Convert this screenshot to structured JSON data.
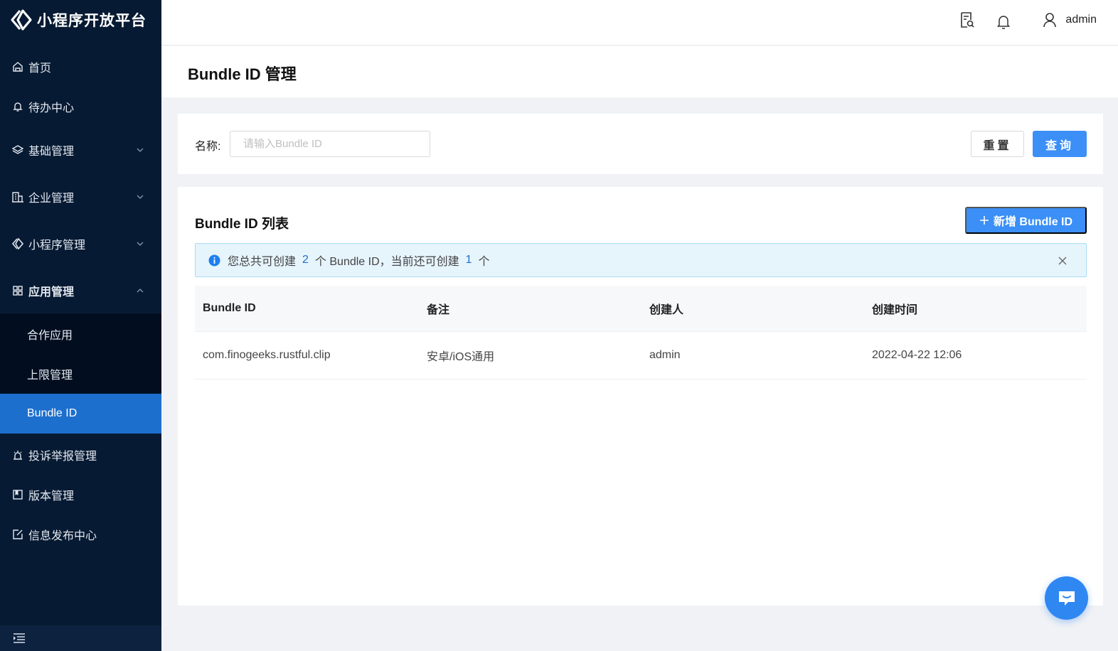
{
  "app": {
    "title": "小程序开放平台",
    "colors": {
      "sidebar": "#071a33",
      "active": "#1d6fce",
      "primary": "#3b8ff7"
    }
  },
  "sidebar": {
    "items": [
      {
        "label": "首页",
        "icon": "home-icon"
      },
      {
        "label": "待办中心",
        "icon": "bell-icon"
      },
      {
        "label": "基础管理",
        "icon": "layers-icon",
        "expandable": true
      },
      {
        "label": "企业管理",
        "icon": "building-icon",
        "expandable": true
      },
      {
        "label": "小程序管理",
        "icon": "miniprogram-icon",
        "expandable": true
      },
      {
        "label": "应用管理",
        "icon": "grid-icon",
        "expandable": true,
        "expanded": true
      },
      {
        "label": "投诉举报管理",
        "icon": "alarm-icon"
      },
      {
        "label": "版本管理",
        "icon": "book-icon"
      },
      {
        "label": "信息发布中心",
        "icon": "edit-icon"
      }
    ],
    "sub_items": [
      {
        "label": "合作应用"
      },
      {
        "label": "上限管理"
      },
      {
        "label": "Bundle ID",
        "active": true
      }
    ]
  },
  "header": {
    "username": "admin"
  },
  "page": {
    "title": "Bundle ID 管理"
  },
  "search": {
    "label": "名称:",
    "placeholder": "请输入Bundle ID",
    "value": "",
    "reset_label": "重置",
    "query_label": "查询"
  },
  "list": {
    "title": "Bundle ID 列表",
    "add_label": "新增 Bundle ID",
    "alert": {
      "prefix": "您总共可创建",
      "total": "2",
      "middle": "个 Bundle ID，当前还可创建",
      "remaining": "1",
      "suffix": "个"
    },
    "columns": [
      "Bundle ID",
      "备注",
      "创建人",
      "创建时间"
    ],
    "rows": [
      [
        "com.finogeeks.rustful.clip",
        "安卓/iOS通用",
        "admin",
        "2022-04-22 12:06"
      ]
    ]
  }
}
